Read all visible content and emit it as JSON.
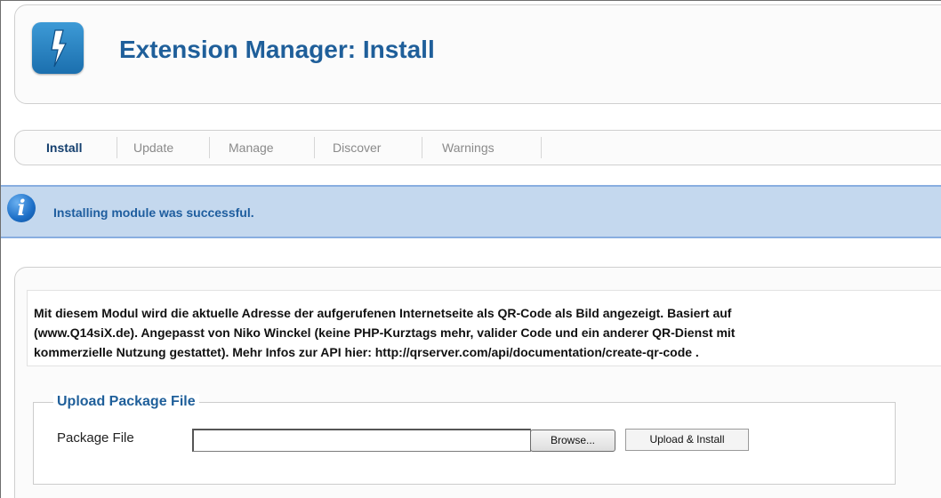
{
  "header": {
    "title": "Extension Manager: Install",
    "icon": "lightning-bolt-icon",
    "icon_color": "#2a85c6"
  },
  "tabs": [
    {
      "label": "Install",
      "active": true
    },
    {
      "label": "Update",
      "active": false
    },
    {
      "label": "Manage",
      "active": false
    },
    {
      "label": "Discover",
      "active": false
    },
    {
      "label": "Warnings",
      "active": false
    }
  ],
  "message": {
    "icon": "info-icon",
    "text": "Installing module was successful.",
    "background": "#c4d8ee"
  },
  "description": {
    "lines": [
      "Mit diesem Modul wird die aktuelle Adresse der aufgerufenen Internetseite als QR-Code als Bild angezeigt. Basiert auf",
      "(www.Q14siX.de). Angepasst von Niko Winckel (keine PHP-Kurztags mehr, valider Code und ein anderer QR-Dienst mit",
      "kommerzielle Nutzung gestattet). Mehr Infos zur API hier: http://qrserver.com/api/documentation/create-qr-code ."
    ]
  },
  "upload": {
    "legend": "Upload Package File",
    "field_label": "Package File",
    "file_value": "",
    "browse_label": "Browse...",
    "install_label": "Upload & Install"
  },
  "colors": {
    "title": "#1f5f9a",
    "active_tab": "#143f6e",
    "inactive_tab": "#8a8a8a"
  }
}
